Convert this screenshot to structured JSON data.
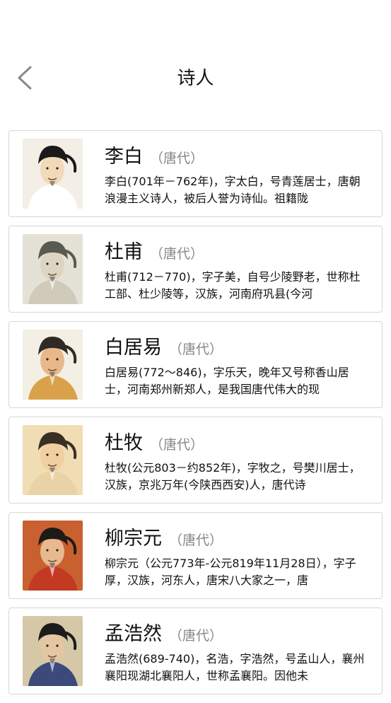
{
  "header": {
    "back_icon": "chevron-left-icon",
    "title": "诗人"
  },
  "poets": [
    {
      "name": "李白",
      "dynasty": "（唐代）",
      "bio": "李白(701年－762年)，字太白，号青莲居士，唐朝浪漫主义诗人，被后人誉为诗仙。祖籍陇",
      "portrait": {
        "bg": "#f3efe6",
        "hat": "#1a1a1a",
        "face": "#f2d9b8",
        "robe": "#ffffff"
      }
    },
    {
      "name": "杜甫",
      "dynasty": "（唐代）",
      "bio": "杜甫(712－770)，字子美，自号少陵野老，世称杜工部、杜少陵等，汉族，河南府巩县(今河",
      "portrait": {
        "bg": "#e4e1d6",
        "hat": "#5a5a50",
        "face": "#ddd5c2",
        "robe": "#cfcab9"
      }
    },
    {
      "name": "白居易",
      "dynasty": "（唐代）",
      "bio": "白居易(772～846)，字乐天，晚年又号称香山居士，河南郑州新郑人，是我国唐代伟大的现",
      "portrait": {
        "bg": "#f4efe4",
        "hat": "#2e2a24",
        "face": "#e8b888",
        "robe": "#d9a24a"
      }
    },
    {
      "name": "杜牧",
      "dynasty": "（唐代）",
      "bio": "杜牧(公元803－约852年)，字牧之，号樊川居士，汉族，京兆万年(今陕西西安)人，唐代诗",
      "portrait": {
        "bg": "#f0ddb4",
        "hat": "#3a2f25",
        "face": "#f0cfa0",
        "robe": "#e9d2a6"
      }
    },
    {
      "name": "柳宗元",
      "dynasty": "（唐代）",
      "bio": "柳宗元（公元773年-公元819年11月28日），字子厚，汉族，河东人，唐宋八大家之一，唐",
      "portrait": {
        "bg": "#c9602f",
        "hat": "#1e1a18",
        "face": "#e8b890",
        "robe": "#c33a22"
      }
    },
    {
      "name": "孟浩然",
      "dynasty": "（唐代）",
      "bio": "孟浩然(689-740)，名浩，字浩然，号孟山人，襄州襄阳现湖北襄阳人，世称孟襄阳。因他未",
      "portrait": {
        "bg": "#d4c8a6",
        "hat": "#1c1c1c",
        "face": "#e4c6a2",
        "robe": "#3b4a7a"
      }
    }
  ]
}
